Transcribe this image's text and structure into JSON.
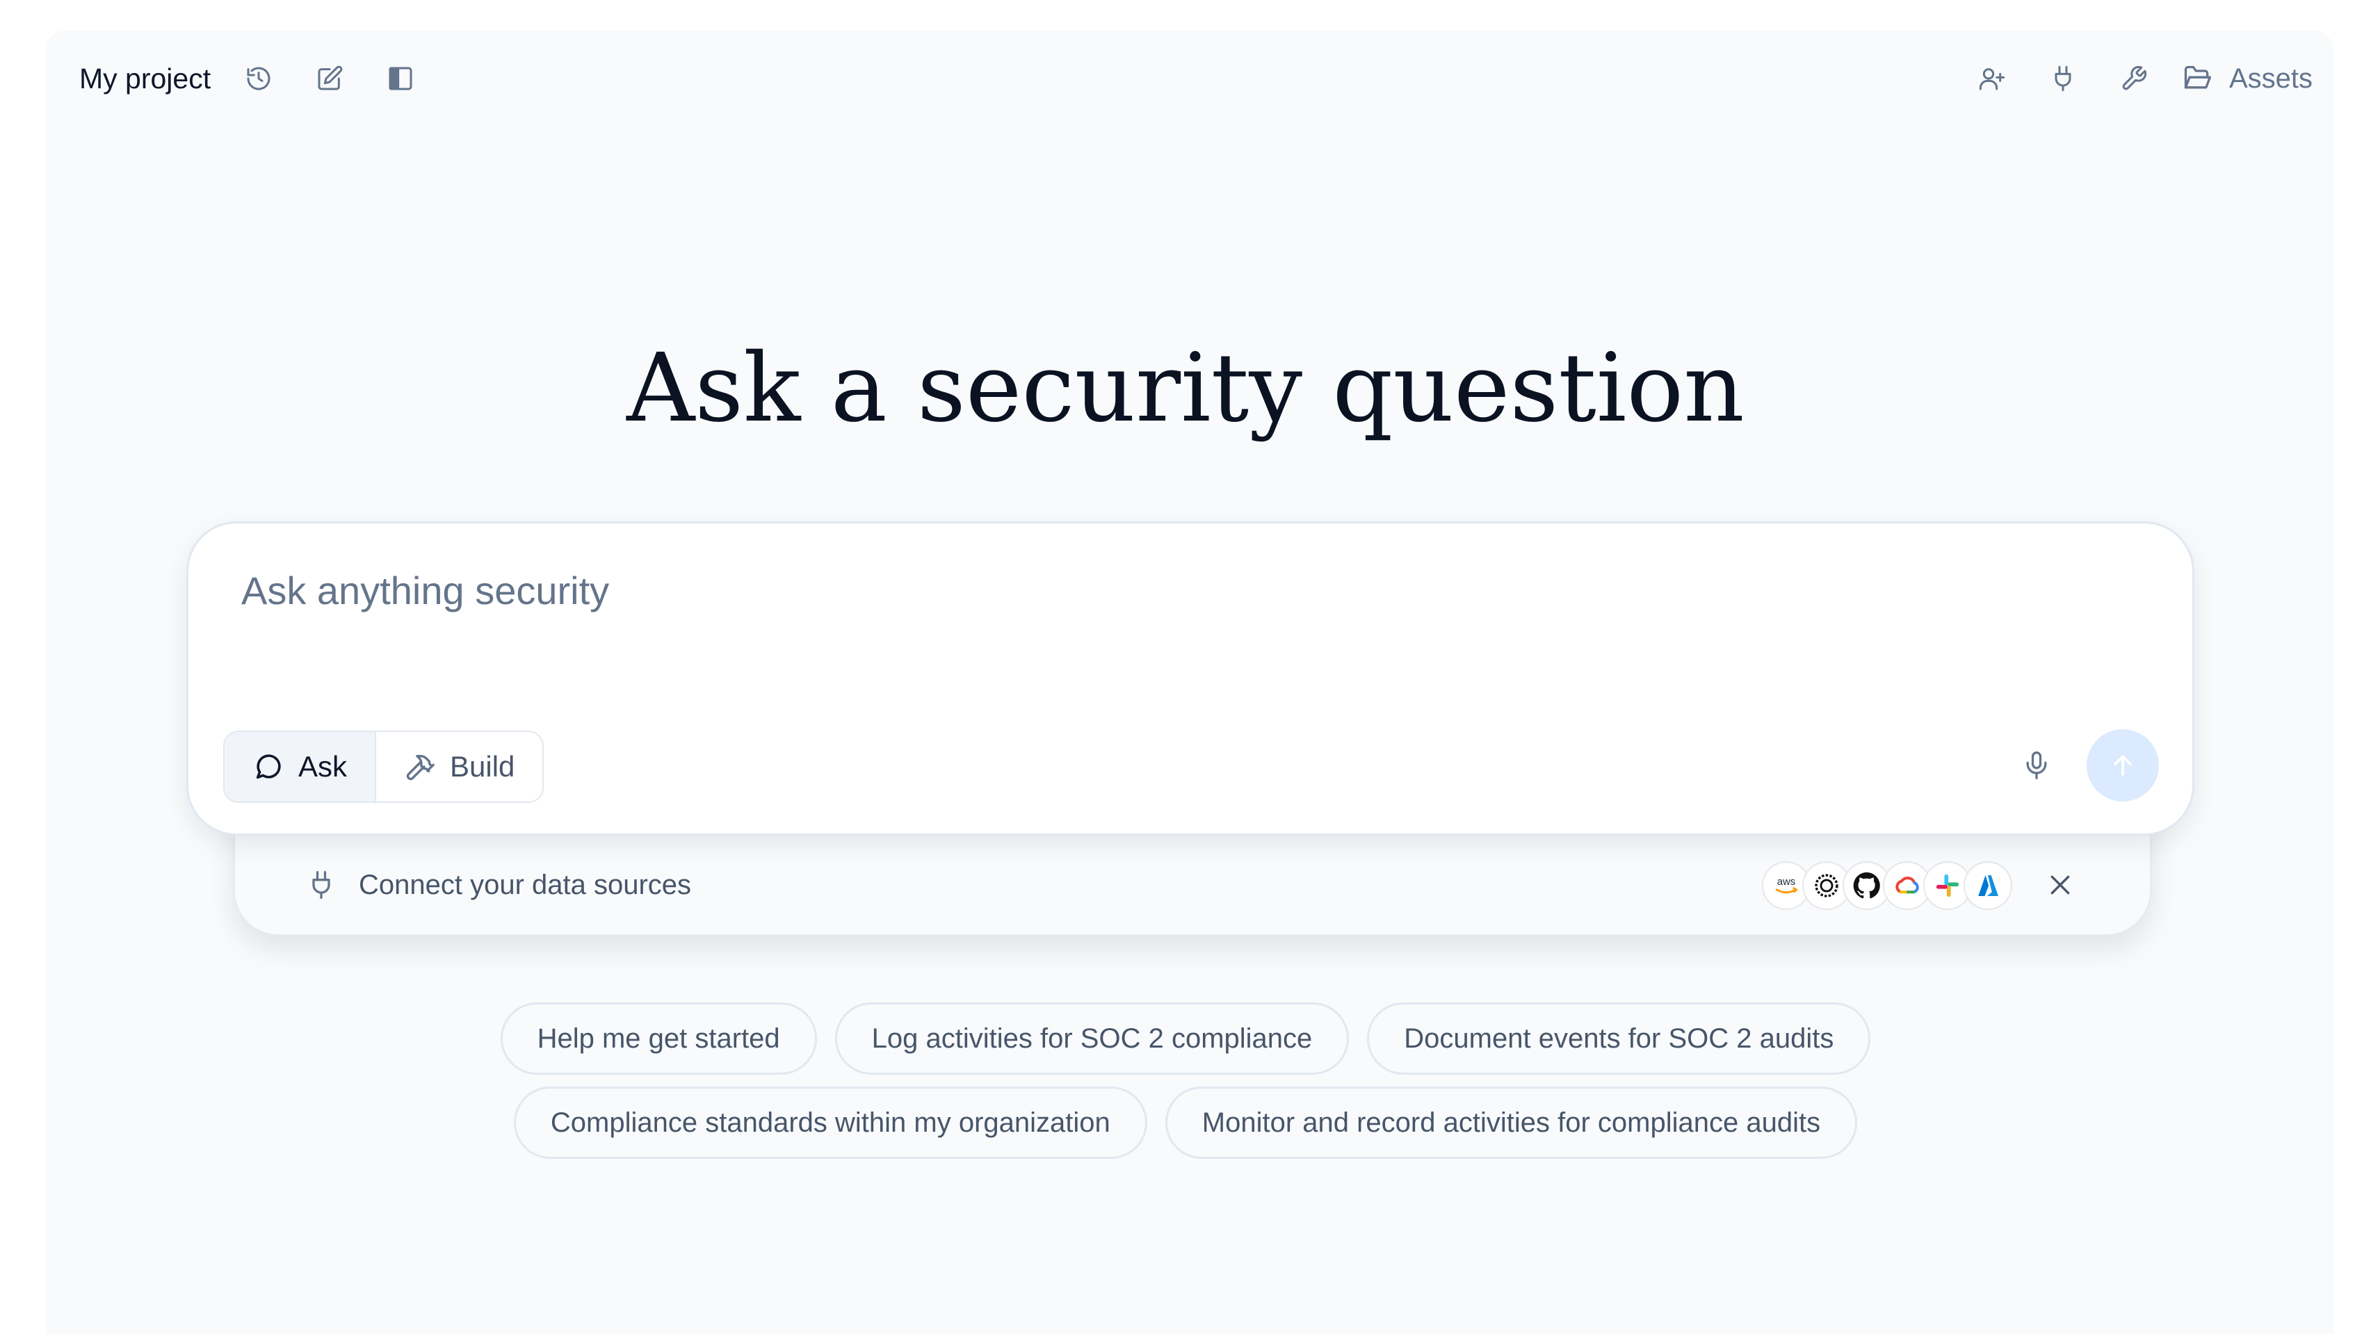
{
  "header": {
    "project_title": "My project",
    "left_icons": [
      "history-icon",
      "edit-icon",
      "sidebar-toggle-icon"
    ],
    "right_icons": [
      "add-user-icon",
      "plug-icon",
      "wrench-icon"
    ],
    "assets_label": "Assets"
  },
  "hero": {
    "title": "Ask a security question"
  },
  "composer": {
    "placeholder": "Ask anything security",
    "value": "",
    "modes": [
      {
        "label": "Ask",
        "icon": "chat-bubble-icon",
        "selected": true
      },
      {
        "label": "Build",
        "icon": "hammer-icon",
        "selected": false
      }
    ],
    "mic_icon": "microphone-icon",
    "send_icon": "arrow-up-icon"
  },
  "connect": {
    "label": "Connect your data sources",
    "providers": [
      "aws",
      "openai",
      "github",
      "google-cloud",
      "slack",
      "azure"
    ],
    "aws_logo_text": "aws"
  },
  "suggestions": {
    "row1": [
      "Help me get started",
      "Log activities for SOC 2 compliance",
      "Document events for SOC 2 audits"
    ],
    "row2": [
      "Compliance standards within my organization",
      "Monitor and record activities for compliance audits"
    ]
  },
  "colors": {
    "background": "#f8fafc",
    "heading": "#0b1222",
    "muted_text": "#475569",
    "send_button": "#dbeafe",
    "border": "#e2e8f0"
  }
}
